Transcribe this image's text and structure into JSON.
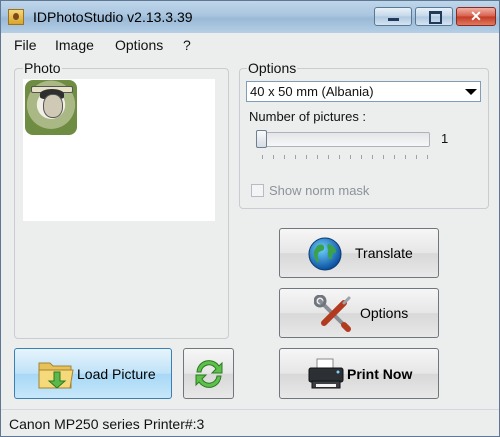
{
  "window": {
    "title": "IDPhotoStudio v2.13.3.39",
    "min_glyph": "–",
    "max_glyph": "□",
    "close_glyph": "✕"
  },
  "menu": [
    "File",
    "Image",
    "Options",
    "?"
  ],
  "photo": {
    "label": "Photo"
  },
  "options": {
    "label": "Options",
    "format_value": "40 x 50 mm (Albania)",
    "number_label": "Number of pictures :",
    "number_value": "1",
    "show_norm_mask_label": "Show norm mask",
    "show_norm_mask_checked": false
  },
  "buttons": {
    "translate": "Translate",
    "options": "Options",
    "load_picture": "Load Picture",
    "print_now": "Print Now"
  },
  "icons": {
    "app": "app-icon",
    "translate": "globe-icon",
    "options": "tools-icon",
    "load": "folder-icon",
    "refresh": "refresh-icon",
    "print": "printer-icon"
  },
  "status": {
    "text": "Canon MP250 series Printer#:3"
  }
}
